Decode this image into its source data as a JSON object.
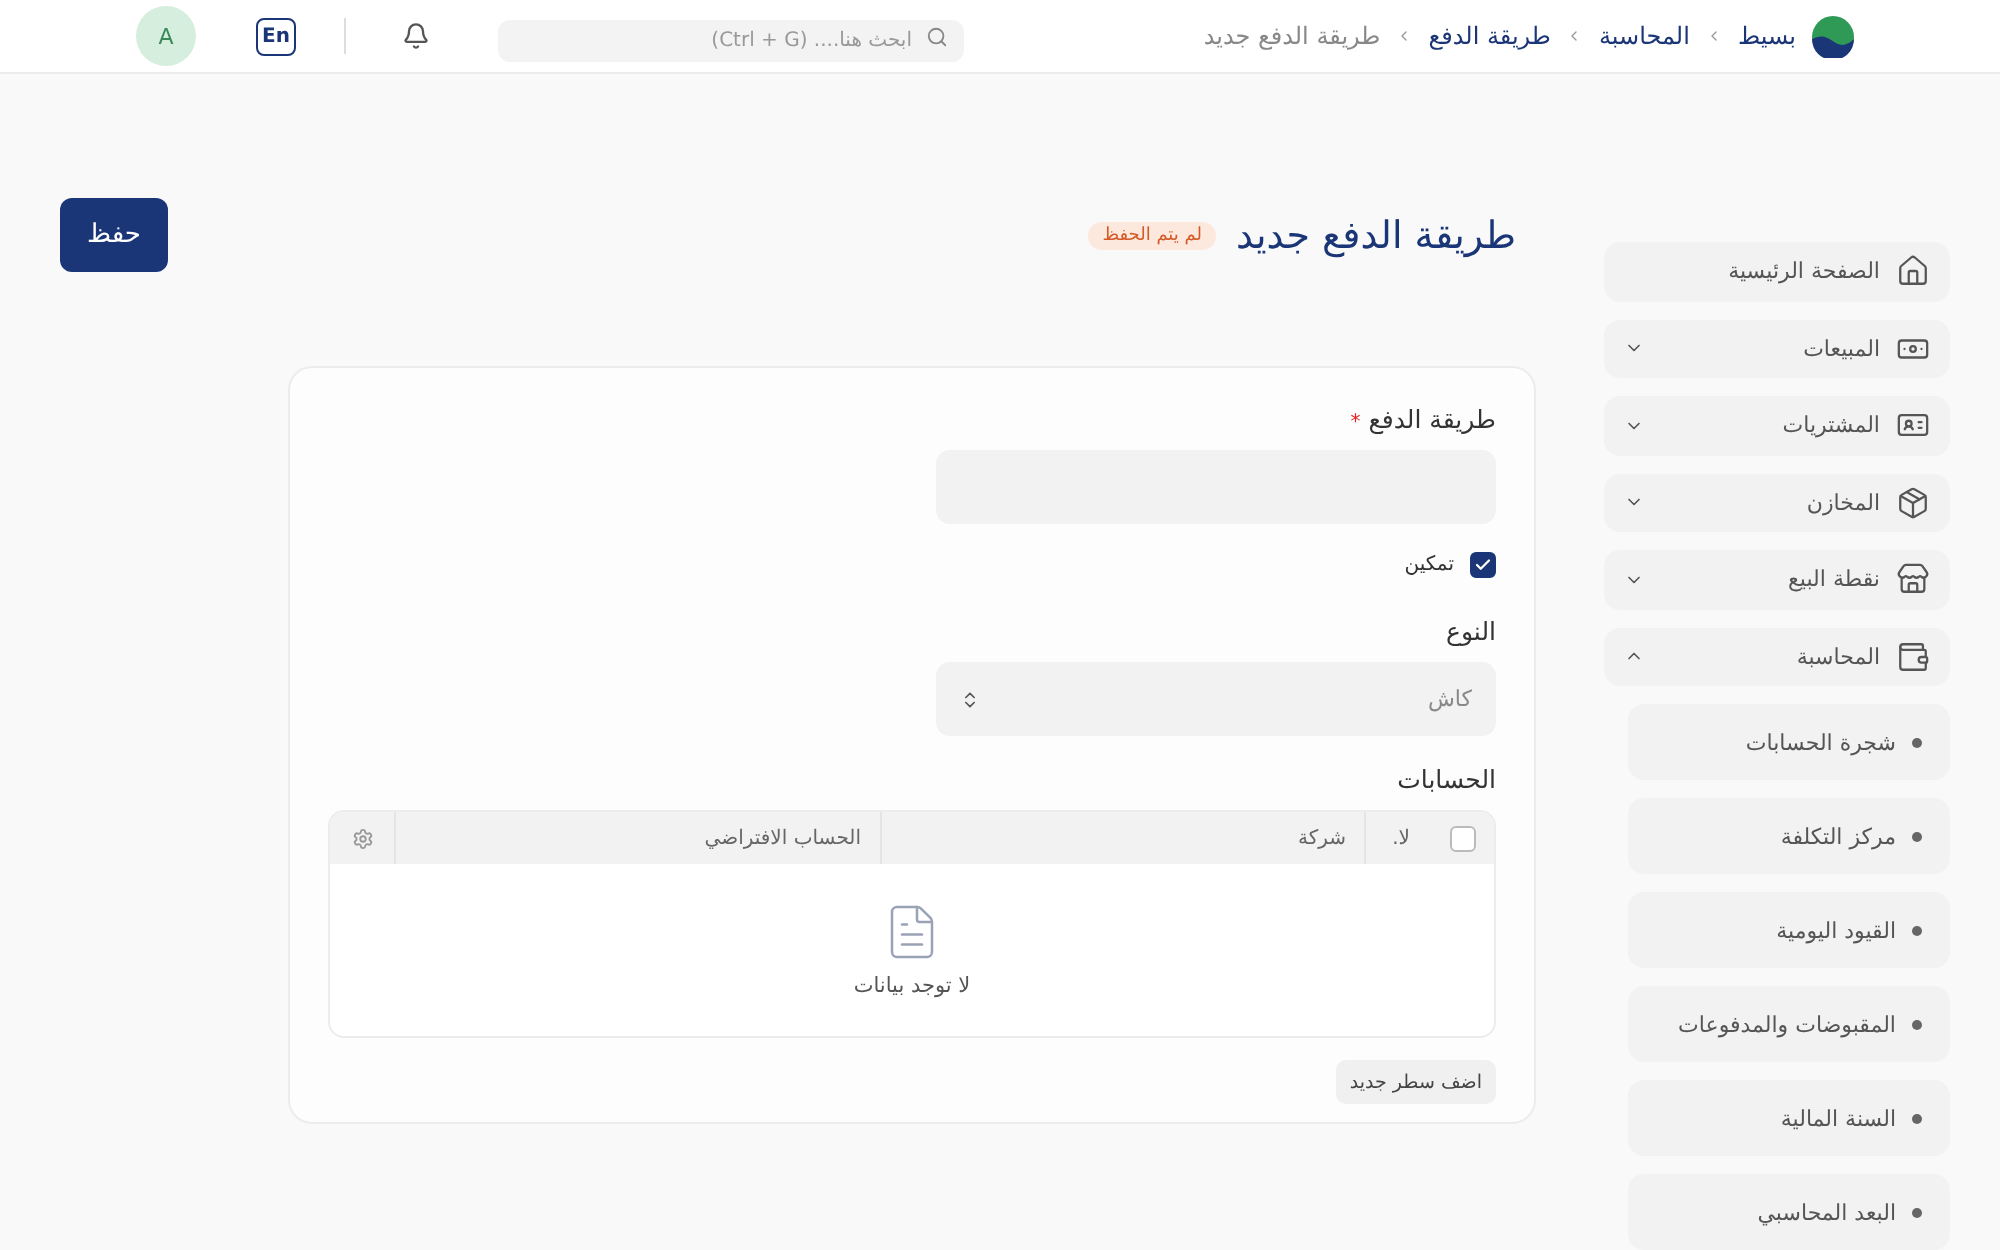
{
  "header": {
    "breadcrumbs": [
      {
        "label": "بسيط",
        "kind": "logo",
        "current": false
      },
      {
        "label": "المحاسبة",
        "kind": "link",
        "current": false
      },
      {
        "label": "طريقة الدفع",
        "kind": "link",
        "current": false
      },
      {
        "label": "طريقة الدفع جديد",
        "kind": "link",
        "current": true
      }
    ],
    "search": {
      "placeholder": "ابحث هنا.... (Ctrl + G)"
    },
    "language_button": "En",
    "avatar": "A"
  },
  "sidebar": {
    "items": [
      {
        "label": "الصفحة الرئيسية",
        "kind": "link"
      },
      {
        "label": "المبيعات",
        "kind": "group",
        "expanded": false
      },
      {
        "label": "المشتريات",
        "kind": "group",
        "expanded": false
      },
      {
        "label": "المخازن",
        "kind": "group",
        "expanded": false
      },
      {
        "label": "نقطة البيع",
        "kind": "group",
        "expanded": false
      },
      {
        "label": "المحاسبة",
        "kind": "group",
        "expanded": true,
        "children": [
          {
            "label": "شجرة الحسابات"
          },
          {
            "label": "مركز التكلفة"
          },
          {
            "label": "القيود اليومية"
          },
          {
            "label": "المقبوضات والمدفوعات"
          },
          {
            "label": "السنة المالية"
          },
          {
            "label": "البعد المحاسبي"
          }
        ]
      }
    ]
  },
  "page": {
    "title": "طريقة الدفع جديد",
    "status_badge": "لم يتم الحفظ",
    "save_button": "حفظ"
  },
  "form": {
    "payment_method": {
      "label": "طريقة الدفع",
      "required_mark": "*"
    },
    "enable": {
      "label": "تمكين",
      "checked": true
    },
    "type": {
      "label": "النوع",
      "value": "كاش"
    },
    "accounts": {
      "label": "الحسابات",
      "select_all_checked": false,
      "columns": [
        {
          "label": "لا."
        },
        {
          "label": "شركة"
        },
        {
          "label": "الحساب الافتراضي"
        }
      ],
      "empty_text": "لا توجد بيانات",
      "add_row_button": "اضف سطر جديد"
    }
  }
}
